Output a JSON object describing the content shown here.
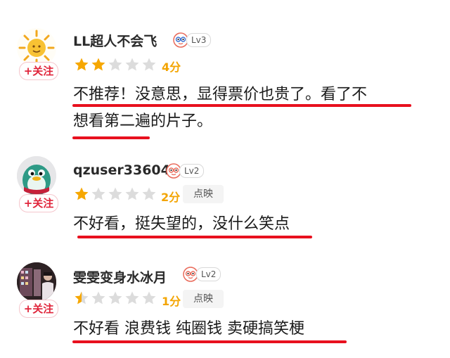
{
  "reviews": [
    {
      "username": "LL超人不会飞",
      "level": "Lv3",
      "follow_label": "+关注",
      "rating_stars": 2,
      "score": "4分",
      "tag": "",
      "content_lines": [
        "不推荐！没意思，显得票价也贵了。看了不",
        "想看第二遍的片子。"
      ]
    },
    {
      "username": "qzuser33604",
      "level": "Lv2",
      "follow_label": "+关注",
      "rating_stars": 1,
      "score": "2分",
      "tag": "点映",
      "content_lines": [
        "不好看，挺失望的，没什么笑点"
      ]
    },
    {
      "username": "雯雯变身水冰月",
      "level": "Lv2",
      "follow_label": "+关注",
      "rating_stars": 0.5,
      "score": "1分",
      "tag": "点映",
      "content_lines": [
        "不好看 浪费钱 纯圈钱 卖硬搞笑梗"
      ]
    }
  ],
  "colors": {
    "star_filled": "#f6a700",
    "star_empty": "#dcdcdc",
    "follow": "#e0243a",
    "underline": "#e8101e"
  }
}
